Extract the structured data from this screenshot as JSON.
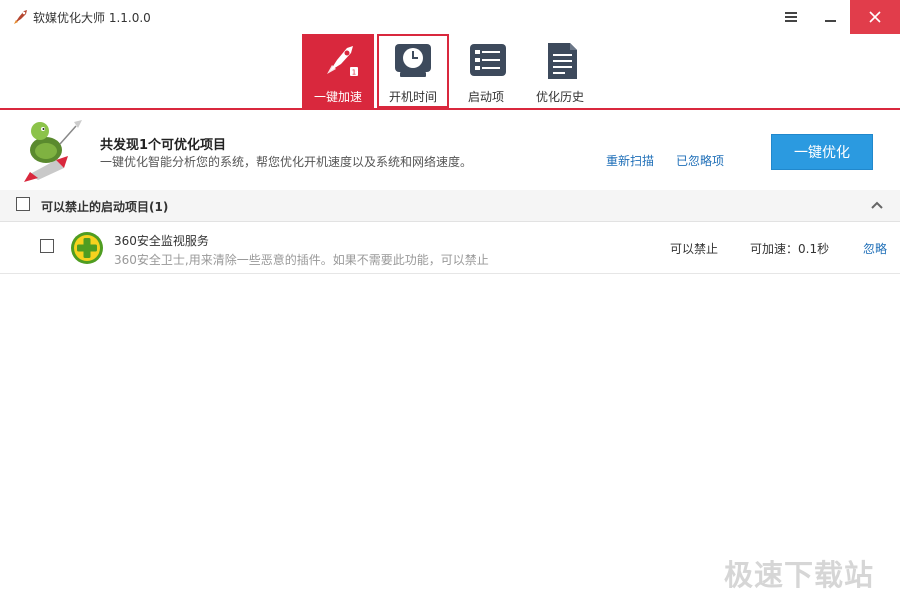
{
  "window": {
    "title": "软媒优化大师 1.1.0.0",
    "close_color": "#e13d4b"
  },
  "toolbar": {
    "accent_color": "#d9283d",
    "items": [
      {
        "label": "一键加速",
        "icon": "rocket-icon",
        "state": "active"
      },
      {
        "label": "开机时间",
        "icon": "clock-icon",
        "state": "highlighted"
      },
      {
        "label": "启动项",
        "icon": "startup-list-icon",
        "state": "normal"
      },
      {
        "label": "优化历史",
        "icon": "history-document-icon",
        "state": "normal"
      }
    ]
  },
  "summary": {
    "title": "共发现1个可优化项目",
    "description": "一键优化智能分析您的系统，帮您优化开机速度以及系统和网络速度。",
    "rescan_label": "重新扫描",
    "ignored_label": "已忽略项",
    "optimize_label": "一键优化",
    "button_color": "#2b9ae0"
  },
  "section": {
    "title": "可以禁止的启动项目(1)"
  },
  "items": [
    {
      "name": "360安全监视服务",
      "description": "360安全卫士,用来清除一些恶意的插件。如果不需要此功能，可以禁止",
      "status": "可以禁止",
      "speedup": "可加速：0.1秒",
      "ignore_label": "忽略",
      "icon": "360-safe-icon"
    }
  ],
  "watermark": "极速下载站"
}
